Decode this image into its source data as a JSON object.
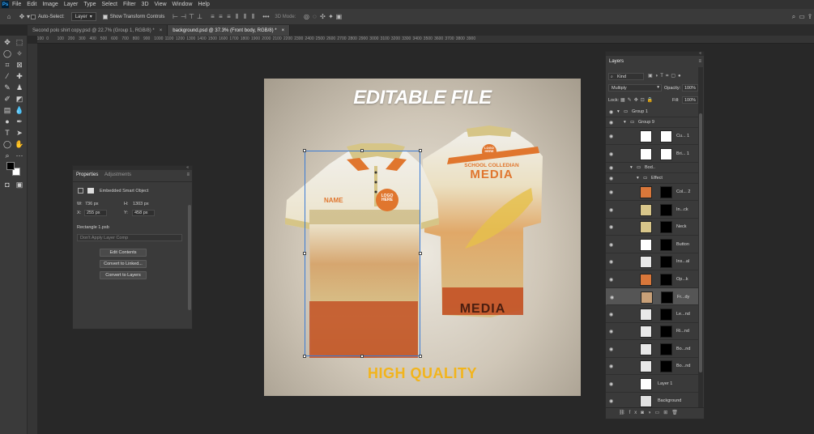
{
  "app": {
    "logo": "Ps",
    "menu": [
      "File",
      "Edit",
      "Image",
      "Layer",
      "Type",
      "Select",
      "Filter",
      "3D",
      "View",
      "Window",
      "Help"
    ]
  },
  "options": {
    "auto_select_label": "Auto-Select:",
    "auto_select_value": "Layer",
    "show_transform_label": "Show Transform Controls",
    "mode_3d_label": "3D Mode:"
  },
  "tabs": [
    {
      "label": "Second polo shirt copy.psd @ 22.7% (Group 1, RGB/8) *",
      "active": false
    },
    {
      "label": "background.psd @ 37.3% (Front body, RGB/8) *",
      "active": true
    }
  ],
  "ruler": {
    "ticks": [
      "-100",
      "0",
      "100",
      "200",
      "300",
      "400",
      "500",
      "600",
      "700",
      "800",
      "900",
      "1000",
      "1100",
      "1200",
      "1300",
      "1400",
      "1500",
      "1600",
      "1700",
      "1800",
      "1900",
      "2000",
      "2100",
      "2200",
      "2300",
      "2400",
      "2500",
      "2600",
      "2700",
      "2800",
      "2900",
      "3000",
      "3100",
      "3200",
      "3300",
      "3400",
      "3500",
      "3600",
      "3700",
      "3800",
      "3900"
    ]
  },
  "canvas": {
    "headline": "EDITABLE FILE",
    "tagline": "HIGH QUALITY",
    "front_name": "NAME",
    "front_logo": "LOGO HERE",
    "back_logo": "LOGO HERE",
    "back_school": "SCHOOL COLLEDIAN",
    "back_media": "MEDIA",
    "back_media_bottom": "MEDIA"
  },
  "properties": {
    "tab_properties": "Properties",
    "tab_adjustments": "Adjustments",
    "object_type": "Embedded Smart Object",
    "w_label": "W:",
    "w_value": "736 px",
    "h_label": "H:",
    "h_value": "1303 px",
    "x_label": "X:",
    "x_value": "255 px",
    "y_label": "Y:",
    "y_value": "458 px",
    "file_name": "Rectangle 1.psb",
    "layer_comp": "Don't Apply Layer Comp",
    "btn_edit": "Edit Contents",
    "btn_linked": "Convert to Linked...",
    "btn_layers": "Convert to Layers"
  },
  "layers": {
    "title": "Layers",
    "filter_kind": "Kind",
    "blend_mode": "Multiply",
    "opacity_label": "Opacity:",
    "opacity_value": "100%",
    "lock_label": "Lock:",
    "fill_label": "Fill:",
    "fill_value": "100%",
    "items": [
      {
        "name": "Group 1",
        "type": "group"
      },
      {
        "name": "Group 9",
        "type": "group"
      },
      {
        "name": "Cu... 1",
        "type": "adjust",
        "thumb": "#ffffff"
      },
      {
        "name": "Bri... 1",
        "type": "adjust",
        "thumb": "#ffffff"
      },
      {
        "name": "Bod..",
        "type": "group"
      },
      {
        "name": "Effect",
        "type": "group"
      },
      {
        "name": "Col... 2",
        "type": "layer",
        "thumb": "#d9773a"
      },
      {
        "name": "In...ck",
        "type": "layer",
        "thumb": "#d8c68a"
      },
      {
        "name": "Neck",
        "type": "layer",
        "thumb": "#d8c68a"
      },
      {
        "name": "Button",
        "type": "layer",
        "thumb": "#ffffff"
      },
      {
        "name": "Ins...al",
        "type": "layer",
        "thumb": "#e8e8e8"
      },
      {
        "name": "Op...k",
        "type": "layer",
        "thumb": "#d9773a"
      },
      {
        "name": "Fr...dy",
        "type": "layer",
        "thumb": "#c8a078"
      },
      {
        "name": "Le...nd",
        "type": "layer",
        "thumb": "#e8e8e8"
      },
      {
        "name": "Ri...nd",
        "type": "layer",
        "thumb": "#e8e8e8"
      },
      {
        "name": "Bo...nd",
        "type": "layer",
        "thumb": "#e8e8e8"
      },
      {
        "name": "Bo...nd",
        "type": "layer",
        "thumb": "#e8e8e8"
      },
      {
        "name": "Layer 1",
        "type": "layer",
        "thumb": "#ffffff"
      },
      {
        "name": "Background",
        "type": "layer",
        "thumb": "#e0e0e0"
      }
    ]
  },
  "colors": {
    "orange": "#e0762e",
    "khaki": "#d6c587",
    "gold": "#f2b41c",
    "ui_bg": "#282828",
    "panel": "#3a3a3a"
  }
}
